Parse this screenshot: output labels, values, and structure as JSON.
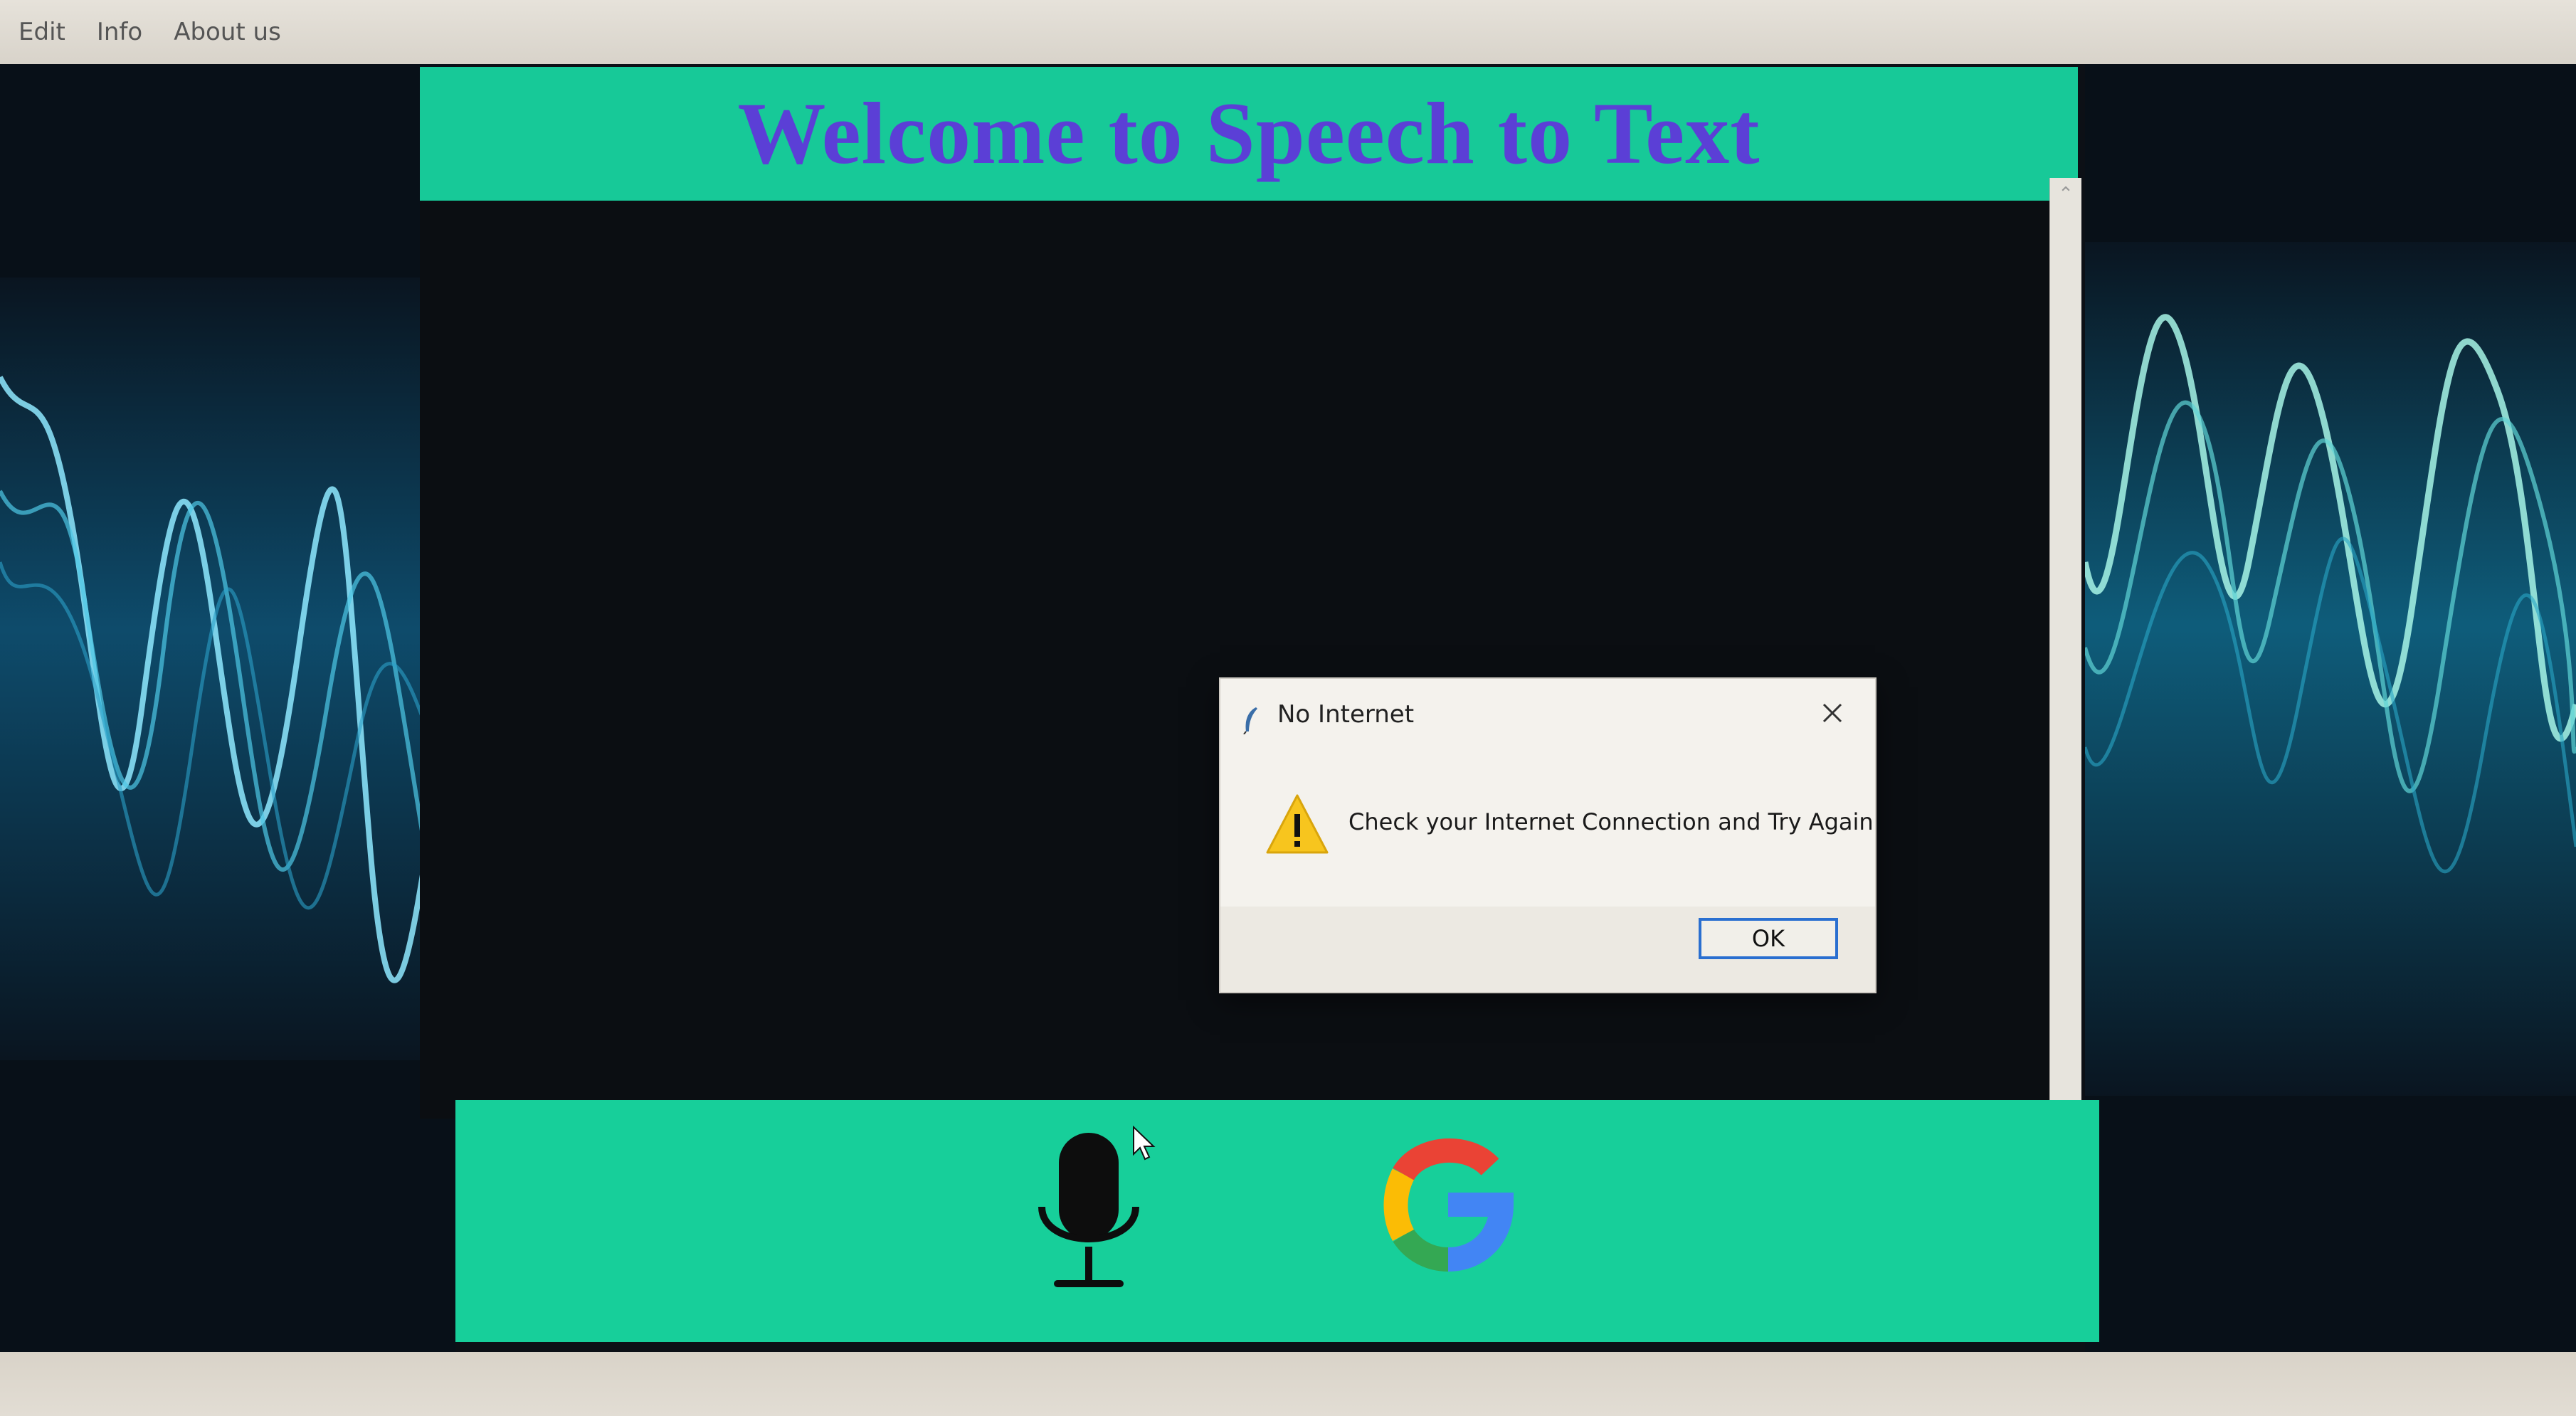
{
  "menu": {
    "items": [
      {
        "label": "Edit"
      },
      {
        "label": "Info"
      },
      {
        "label": "About us"
      }
    ]
  },
  "app": {
    "title": "Welcome to Speech to Text",
    "title_color": "#5b3fd6",
    "banner_color": "#17c998",
    "bottom_bar_color": "#17cf9a",
    "mic_icon": "microphone-icon",
    "google_icon": "google-g-icon"
  },
  "dialog": {
    "title": "No Internet",
    "message": "Check your Internet Connection and Try Again",
    "ok_label": "OK",
    "title_icon": "feather-icon",
    "message_icon": "warning-icon",
    "close_icon": "close-icon"
  }
}
